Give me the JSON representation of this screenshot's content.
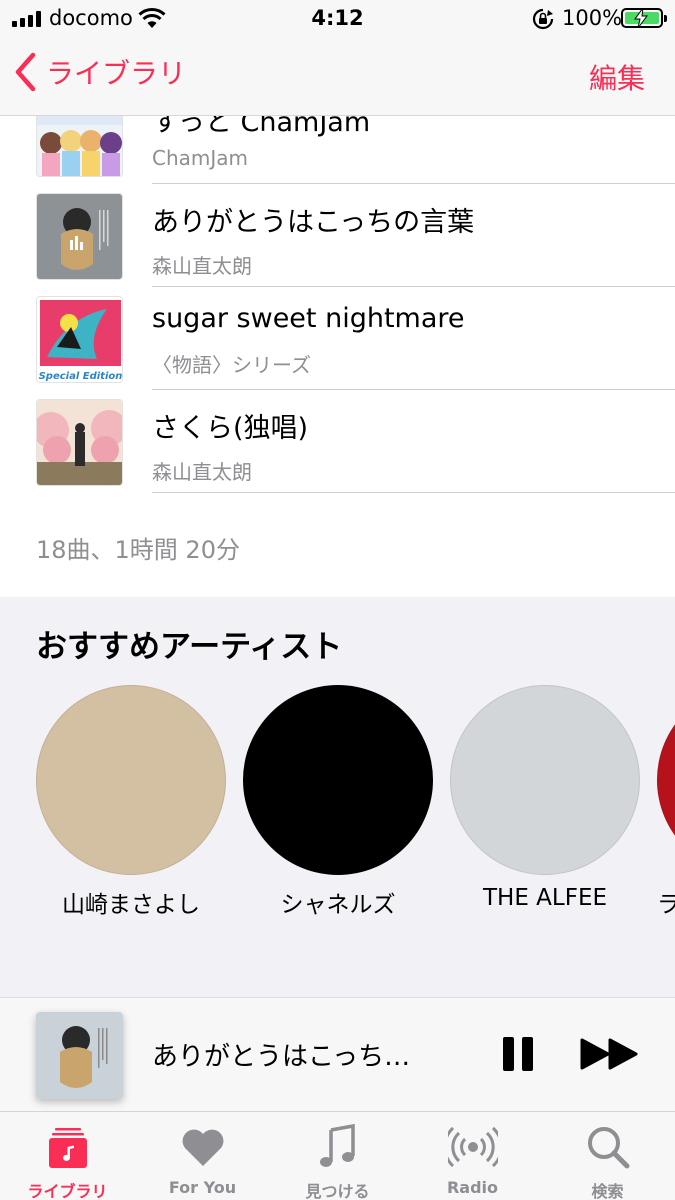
{
  "status_bar": {
    "carrier": "docomo",
    "time": "4:12",
    "battery_percent": "100%"
  },
  "nav": {
    "back_label": "ライブラリ",
    "edit_label": "編集"
  },
  "songs": [
    {
      "title": "すっと ChamJam",
      "artist": "ChamJam"
    },
    {
      "title": "ありがとうはこっちの言葉",
      "artist": "森山直太朗"
    },
    {
      "title": "sugar sweet nightmare",
      "artist": "〈物語〉シリーズ"
    },
    {
      "title": "さくら(独唱)",
      "artist": "森山直太朗"
    }
  ],
  "art_labels": {
    "special_edition": "Special Edition"
  },
  "summary": "18曲、1時間 20分",
  "recommended": {
    "title": "おすすめアーティスト",
    "artists": [
      {
        "name": "山崎まさよし",
        "color": "#d3bfa2"
      },
      {
        "name": "シャネルズ",
        "color": "#000000"
      },
      {
        "name": "THE ALFEE",
        "color": "#d3d6d9"
      },
      {
        "name": "ラ",
        "color": "#b5121b"
      }
    ]
  },
  "now_playing": {
    "title": "ありがとうはこっち…"
  },
  "tabs": [
    {
      "label": "ライブラリ",
      "icon": "library-icon",
      "active": true
    },
    {
      "label": "For You",
      "icon": "heart-icon",
      "active": false
    },
    {
      "label": "見つける",
      "icon": "music-note-icon",
      "active": false
    },
    {
      "label": "Radio",
      "icon": "radio-icon",
      "active": false
    },
    {
      "label": "検索",
      "icon": "search-icon",
      "active": false
    }
  ],
  "colors": {
    "accent": "#fa2d55",
    "secondary_text": "#8e8e93",
    "battery": "#4cd964"
  }
}
